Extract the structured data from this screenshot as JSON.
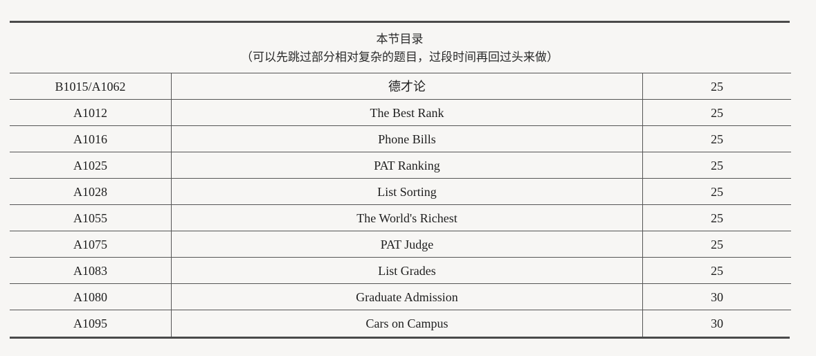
{
  "section_header": {
    "title": "本节目录",
    "subtitle": "（可以先跳过部分相对复杂的题目，过段时间再回过头来做）"
  },
  "problems": [
    {
      "id": "B1015/A1062",
      "title": "德才论",
      "score": "25"
    },
    {
      "id": "A1012",
      "title": "The Best Rank",
      "score": "25"
    },
    {
      "id": "A1016",
      "title": "Phone Bills",
      "score": "25"
    },
    {
      "id": "A1025",
      "title": "PAT Ranking",
      "score": "25"
    },
    {
      "id": "A1028",
      "title": "List Sorting",
      "score": "25"
    },
    {
      "id": "A1055",
      "title": "The World's Richest",
      "score": "25"
    },
    {
      "id": "A1075",
      "title": "PAT Judge",
      "score": "25"
    },
    {
      "id": "A1083",
      "title": "List Grades",
      "score": "25"
    },
    {
      "id": "A1080",
      "title": "Graduate Admission",
      "score": "30"
    },
    {
      "id": "A1095",
      "title": "Cars on Campus",
      "score": "30"
    }
  ]
}
